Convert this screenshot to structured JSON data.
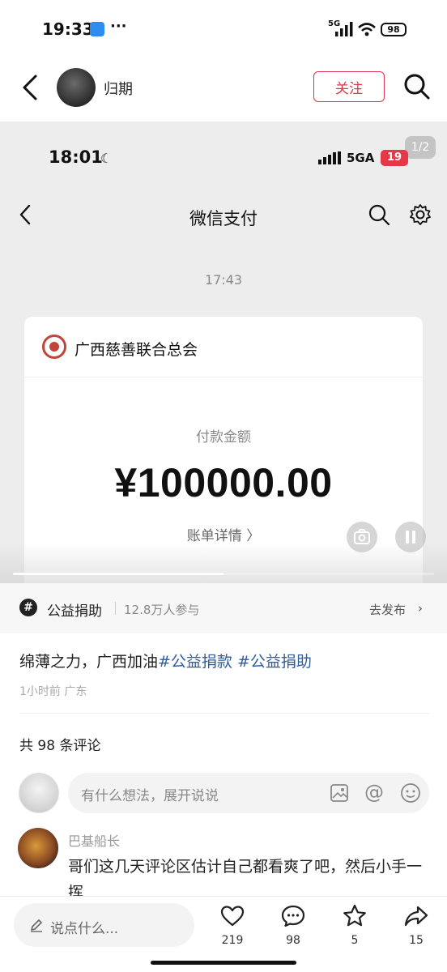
{
  "status_bar": {
    "time": "19:33",
    "more": "···",
    "network": "5G",
    "battery": "98"
  },
  "header": {
    "username": "归期",
    "follow_label": "关注"
  },
  "image": {
    "page_indicator": "1/2",
    "status_time": "18:01",
    "status_network": "5GA",
    "status_battery": "19",
    "nav_title": "微信支付",
    "message_time": "17:43",
    "card": {
      "org_name": "广西慈善联合总会",
      "amount_label": "付款金额",
      "amount": "¥100000.00",
      "bill_link": "账单详情 〉"
    },
    "progress": 0.5
  },
  "topic": {
    "name": "公益捐助",
    "participants": "12.8万人参与",
    "action": "去发布"
  },
  "post": {
    "text": "绵薄之力，广西加油",
    "tags": [
      "#公益捐款",
      "#公益捐助"
    ],
    "meta": "1小时前 广东"
  },
  "comments": {
    "count_label": "共 98 条评论",
    "input_placeholder": "有什么想法，展开说说",
    "items": [
      {
        "user": "巴基船长",
        "text": "哥们这几天评论区估计自己都看爽了吧，然后小手一挥"
      }
    ]
  },
  "bottom_bar": {
    "say_placeholder": "说点什么...",
    "likes": "219",
    "comments": "98",
    "favorites": "5",
    "shares": "15"
  },
  "colors": {
    "accent": "#e0344d",
    "tag": "#2f5d9a"
  }
}
